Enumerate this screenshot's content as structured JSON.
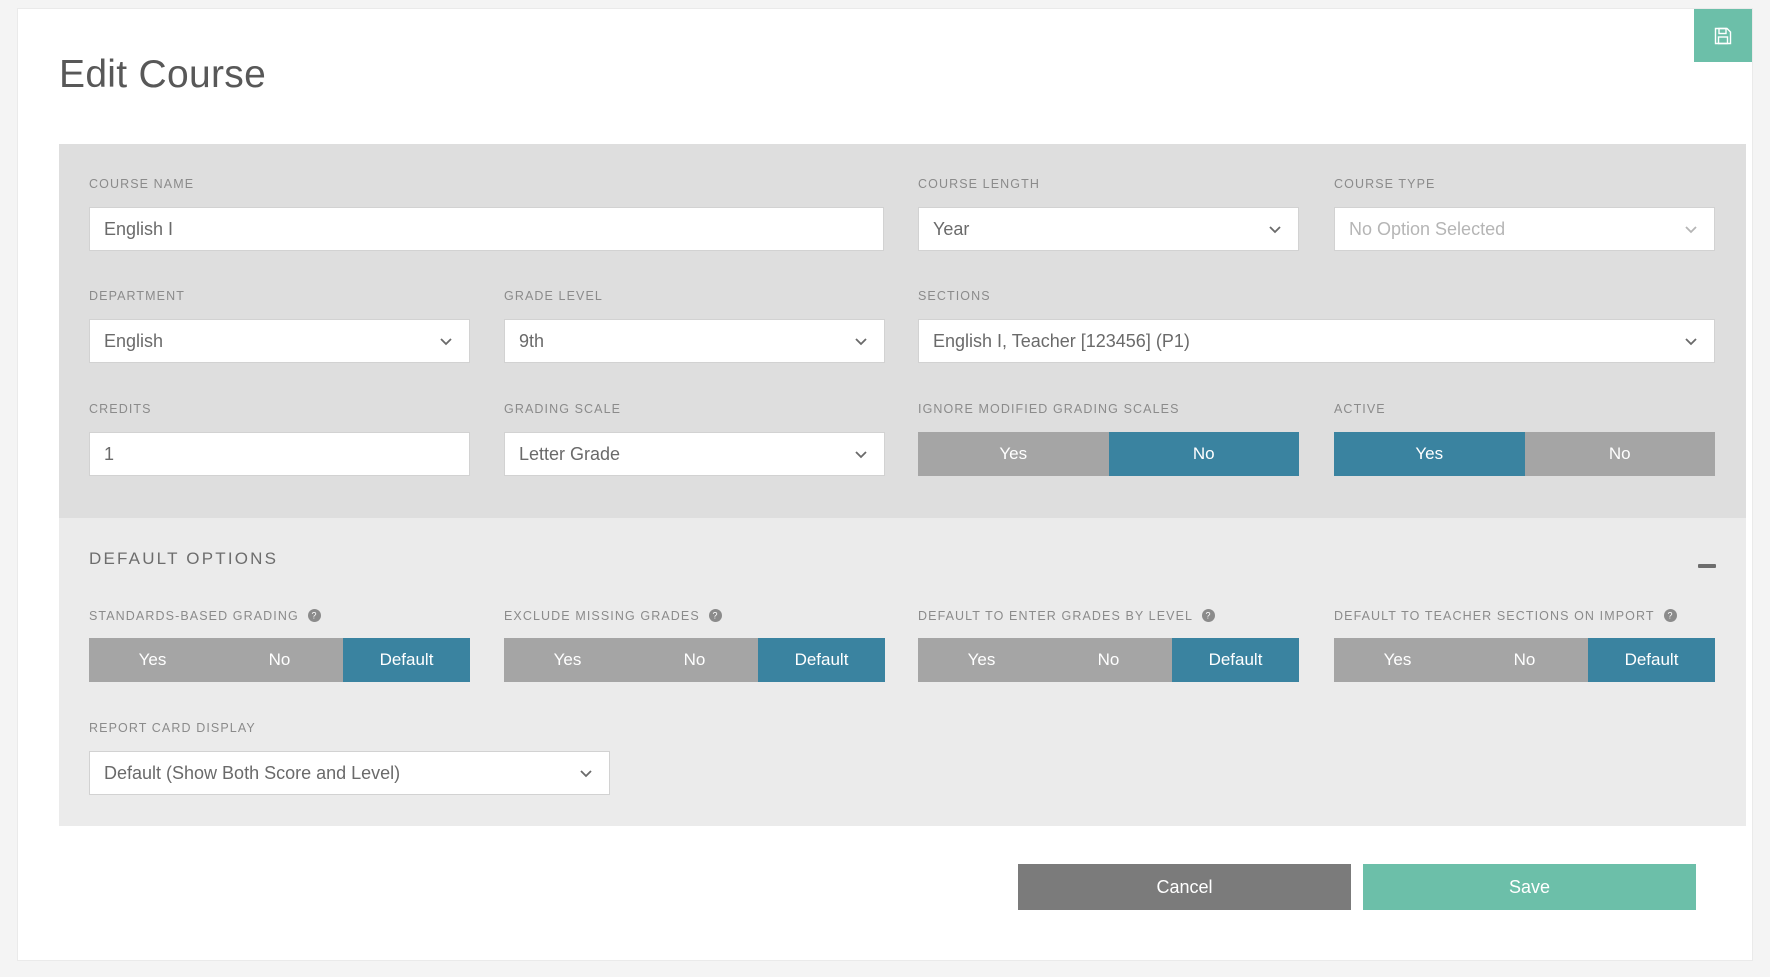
{
  "window": {
    "title": "Edit Course"
  },
  "header": {
    "save_icon": "floppy-disk-save-icon"
  },
  "form": {
    "course_name": {
      "label": "COURSE NAME",
      "value": "English I"
    },
    "course_length": {
      "label": "COURSE LENGTH",
      "value": "Year"
    },
    "course_type": {
      "label": "COURSE TYPE",
      "placeholder": "No Option Selected",
      "value": "No Option Selected"
    },
    "department": {
      "label": "DEPARTMENT",
      "value": "English"
    },
    "grade_level": {
      "label": "GRADE LEVEL",
      "value": "9th"
    },
    "sections": {
      "label": "SECTIONS",
      "value": "English I, Teacher [123456] (P1)"
    },
    "credits": {
      "label": "CREDITS",
      "value": "1"
    },
    "grading_scale": {
      "label": "GRADING SCALE",
      "value": "Letter Grade"
    },
    "ignore_modified_grading_scales": {
      "label": "IGNORE MODIFIED GRADING SCALES",
      "options": [
        "Yes",
        "No"
      ],
      "selected": "No"
    },
    "active": {
      "label": "ACTIVE",
      "options": [
        "Yes",
        "No"
      ],
      "selected": "Yes"
    }
  },
  "default_options": {
    "heading": "DEFAULT OPTIONS",
    "collapse_icon": "minus-collapse-icon",
    "items": [
      {
        "label": "STANDARDS-BASED GRADING",
        "help_icon": "help-circle-icon",
        "options": [
          "Yes",
          "No",
          "Default"
        ],
        "selected": "Default"
      },
      {
        "label": "EXCLUDE MISSING GRADES",
        "help_icon": "help-circle-icon",
        "options": [
          "Yes",
          "No",
          "Default"
        ],
        "selected": "Default"
      },
      {
        "label": "DEFAULT TO ENTER GRADES BY LEVEL",
        "help_icon": "help-circle-icon",
        "options": [
          "Yes",
          "No",
          "Default"
        ],
        "selected": "Default"
      },
      {
        "label": "DEFAULT TO TEACHER SECTIONS ON IMPORT",
        "help_icon": "help-circle-icon",
        "options": [
          "Yes",
          "No",
          "Default"
        ],
        "selected": "Default"
      }
    ],
    "report_card_display": {
      "label": "REPORT CARD DISPLAY",
      "value": "Default (Show Both Score and Level)"
    }
  },
  "footer": {
    "cancel_label": "Cancel",
    "save_label": "Save"
  },
  "colors": {
    "accent_teal": "#6cbfa9",
    "toggle_active": "#3a83a0",
    "toggle_inactive": "#a5a5a5",
    "cancel_gray": "#7b7b7b",
    "panel_top": "#dedede",
    "panel_bottom": "#ebebeb"
  }
}
